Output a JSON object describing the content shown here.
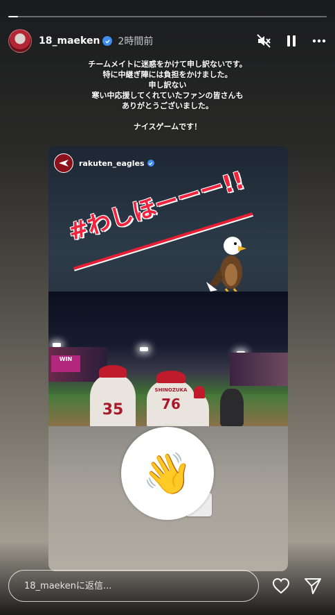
{
  "story": {
    "progress_fraction": 0.03
  },
  "header": {
    "username": "18_maeken",
    "time_ago": "2時間前",
    "mute_icon": "speaker-muted-icon",
    "pause_icon": "pause-icon",
    "more_icon": "ellipsis-icon"
  },
  "caption": {
    "lines": [
      "チームメイトに迷惑をかけて申し訳ないです。",
      "特に中継ぎ陣には負担をかけました。",
      "申し訳ない",
      "寒い中応援してくれていたファンの皆さんも",
      "ありがとうございました。",
      "",
      "ナイスゲームです！"
    ]
  },
  "shared_post": {
    "username": "rakuten_eagles",
    "hashtag": "#わしほーーー!!",
    "jersey_numbers": [
      "35",
      "76"
    ],
    "jersey_name": "SHINOZUKA"
  },
  "sticker": {
    "emoji": "👋"
  },
  "footer": {
    "reply_placeholder": "18_maekenに返信...",
    "like_icon": "heart-icon",
    "share_icon": "send-icon"
  }
}
